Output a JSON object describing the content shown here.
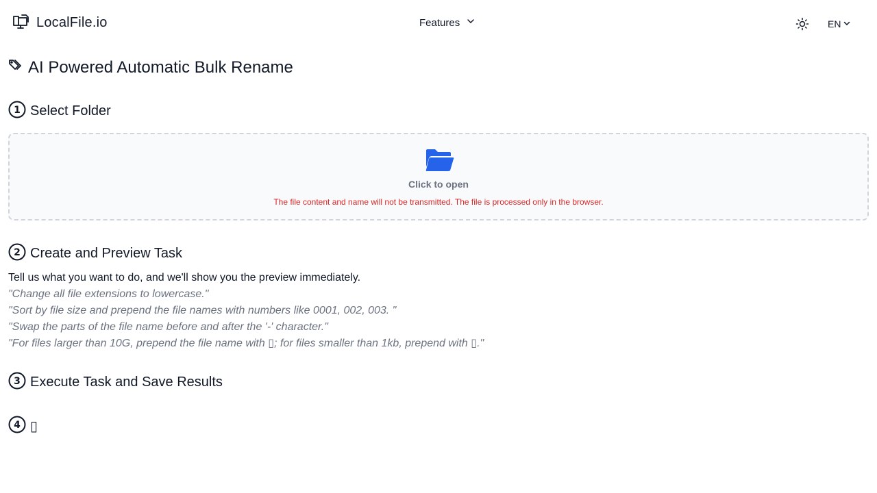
{
  "header": {
    "logo_text": "LocalFile.io",
    "features_label": "Features",
    "language_label": "EN"
  },
  "page": {
    "title": "AI Powered Automatic Bulk Rename"
  },
  "steps": [
    {
      "number": "1",
      "title": "Select Folder"
    },
    {
      "number": "2",
      "title": "Create and Preview Task"
    },
    {
      "number": "3",
      "title": "Execute Task and Save Results"
    },
    {
      "number": "4",
      "title": "▯"
    }
  ],
  "dropzone": {
    "open_label": "Click to open",
    "notice": "The file content and name will not be transmitted. The file is processed only in the browser."
  },
  "task": {
    "description": "Tell us what you want to do, and we'll show you the preview immediately.",
    "examples": [
      "\"Change all file extensions to lowercase.\"",
      "\"Sort by file size and prepend the file names with numbers like 0001, 002, 003. \"",
      "\"Swap the parts of the file name before and after the '-' character.\"",
      "\"For files larger than 10G, prepend the file name with ▯; for files smaller than 1kb, prepend with ▯.\""
    ]
  },
  "colors": {
    "accent": "#2563eb",
    "notice": "#dc2626",
    "muted": "#6b7280",
    "dropzone_bg": "#f9fafb",
    "dropzone_border": "#d1d5db"
  },
  "icons": {
    "logo": "monitor-file-icon",
    "features_chevron": "chevron-down-icon",
    "theme": "sun-icon",
    "language_chevron": "chevron-down-icon",
    "title": "tags-icon",
    "folder": "folder-open-icon"
  }
}
